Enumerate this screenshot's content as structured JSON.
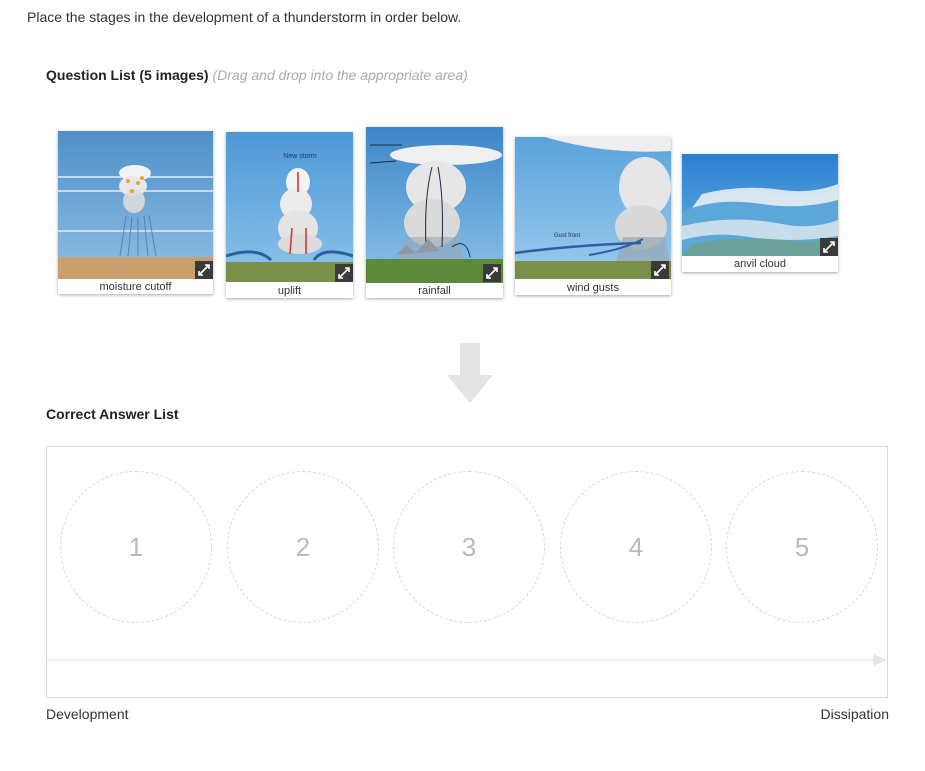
{
  "prompt": "Place the stages in the development of a thunderstorm in order below.",
  "question_list": {
    "heading": "Question List (5 images)",
    "hint": "(Drag and drop into the appropriate area)",
    "items": [
      {
        "caption": "moisture cutoff"
      },
      {
        "caption": "uplift",
        "image_label": "New storm"
      },
      {
        "caption": "rainfall"
      },
      {
        "caption": "wind gusts",
        "image_label": "Gust front"
      },
      {
        "caption": "anvil cloud"
      }
    ]
  },
  "answer_list": {
    "heading": "Correct Answer List",
    "slots": [
      "1",
      "2",
      "3",
      "4",
      "5"
    ]
  },
  "scale": {
    "left": "Development",
    "right": "Dissipation"
  },
  "icons": {
    "expand": "expand-icon",
    "arrow": "arrow-down-icon"
  },
  "colors": {
    "sky": "#5aa3dc",
    "ground": "#c8a070",
    "slot_border": "#d8d8d8",
    "slot_text": "#bbbbbb",
    "arrow": "#e3e3e3"
  }
}
